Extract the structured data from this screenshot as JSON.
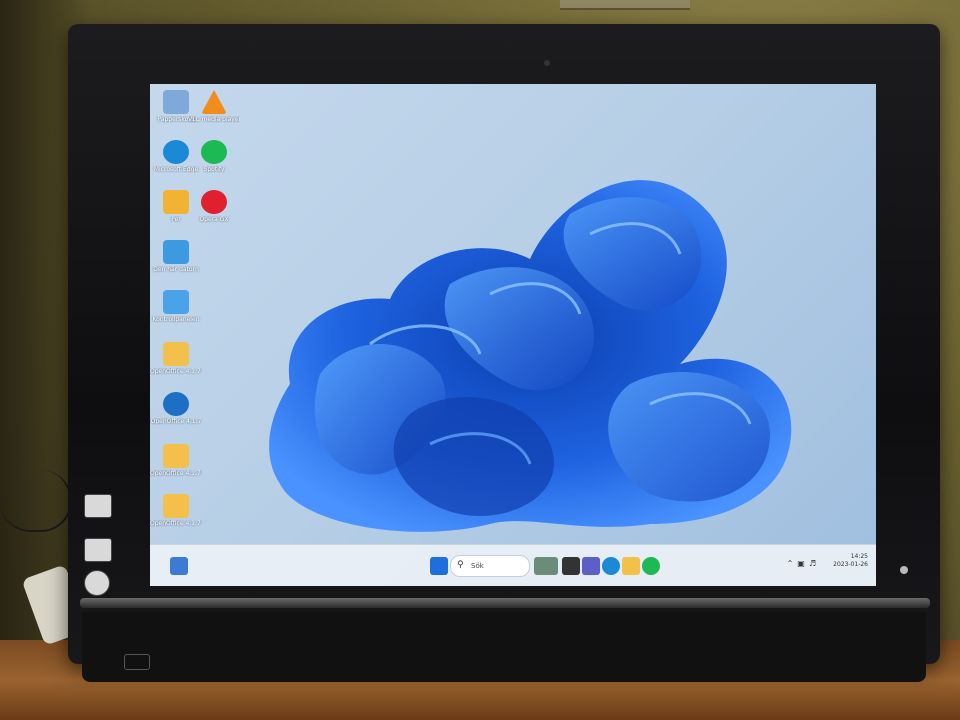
{
  "desktop": {
    "icons": [
      {
        "label": "Papperskorg",
        "icon": "recycle-bin-icon",
        "color": "#7fa9d8"
      },
      {
        "label": "VLC media player",
        "icon": "vlc-icon",
        "color": "#f28c1d"
      },
      {
        "label": "Microsoft Edge",
        "icon": "edge-icon",
        "color": "#1b8ad6"
      },
      {
        "label": "Spotify",
        "icon": "spotify-icon",
        "color": "#1db954"
      },
      {
        "label": "Per",
        "icon": "user-folder-icon",
        "color": "#f2b233"
      },
      {
        "label": "Opera GX",
        "icon": "opera-icon",
        "color": "#e0202e"
      },
      {
        "label": "Den här datorn",
        "icon": "computer-icon",
        "color": "#3c9be0"
      },
      {
        "label": "Kontrollpanelen",
        "icon": "control-panel-icon",
        "color": "#4aa3e8"
      },
      {
        "label": "OpenOffice 4.1.7 Lan...",
        "icon": "folder-icon",
        "color": "#f2c04b"
      },
      {
        "label": "OpenOffice 4.1.7",
        "icon": "openoffice-icon",
        "color": "#1c6fc2"
      },
      {
        "label": "OpenOffice 4.1.7 Lan...",
        "icon": "folder-icon",
        "color": "#f2c04b"
      },
      {
        "label": "OpenOffice 4.1.7 Inst...",
        "icon": "folder-icon",
        "color": "#f2c04b"
      }
    ]
  },
  "taskbar": {
    "search_placeholder": "Sök",
    "apps": [
      "windows-start-icon",
      "widgets-icon",
      "task-view-icon",
      "chat-icon",
      "edge-icon",
      "file-explorer-icon",
      "spotify-icon"
    ],
    "clock_time": "14:25",
    "clock_date": "2023-01-26",
    "tray_icons": [
      "chevron-up-icon",
      "network-icon",
      "volume-icon"
    ]
  },
  "colors": {
    "wallpaper_accent": "#1f63e0",
    "wallpaper_bg": "#c4d8ec",
    "taskbar_bg": "#ebf0f6"
  }
}
